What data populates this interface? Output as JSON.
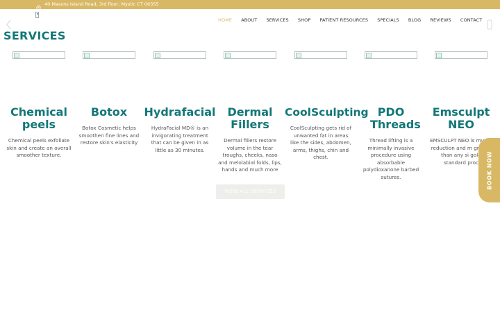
{
  "topbar": {
    "address": "40 Masons Island Road, 3rd floor, Mystic CT 06355",
    "icon": "map-pin-icon"
  },
  "nav": {
    "items": [
      {
        "label": "HOME",
        "active": true
      },
      {
        "label": "ABOUT",
        "active": false
      },
      {
        "label": "SERVICES",
        "active": false
      },
      {
        "label": "SHOP",
        "active": false
      },
      {
        "label": "PATIENT RESOURCES",
        "active": false
      },
      {
        "label": "SPECIALS",
        "active": false
      },
      {
        "label": "BLOG",
        "active": false
      },
      {
        "label": "REVIEWS",
        "active": false
      },
      {
        "label": "CONTACT",
        "active": false
      }
    ]
  },
  "carousel": {
    "prev_icon": "chevron-left-icon",
    "next_icon": "chevron-right-icon"
  },
  "services": {
    "title": "SERVICES",
    "cards": [
      {
        "name": "Chemical peels",
        "desc": "Chemical peels exfoliate skin and create an overall smoother texture."
      },
      {
        "name": "Botox",
        "desc": "Botox Cosmetic helps smoothen fine lines and restore skin's elasticity"
      },
      {
        "name": "Hydrafacial",
        "desc": "HydraFacial MD® is an invigorating treatment that can be given in as little as 30 minutes."
      },
      {
        "name": "Dermal Fillers",
        "desc": "Dermal fillers restore volume in the tear troughs, cheeks, naso and melolabial folds, lips, hands and much more"
      },
      {
        "name": "CoolSculpting",
        "desc": "CoolSculpting gets rid of unwanted fat in areas like the sides, abdomen, arms, thighs, chin and chest."
      },
      {
        "name": "PDO Threads",
        "desc": "Thread lifting is a minimally invasive procedure using absorbable polydioxanone barbed sutures."
      },
      {
        "name": "Emsculpt NEO",
        "desc": "EMSCULPT NEO is my fat reduction and m growth than any si gold standard proc"
      }
    ],
    "cta": "VIEW ALL SERVICES"
  },
  "book_now": "BOOK NOW",
  "colors": {
    "accent_gold": "#d9b865",
    "teal": "#137777"
  }
}
